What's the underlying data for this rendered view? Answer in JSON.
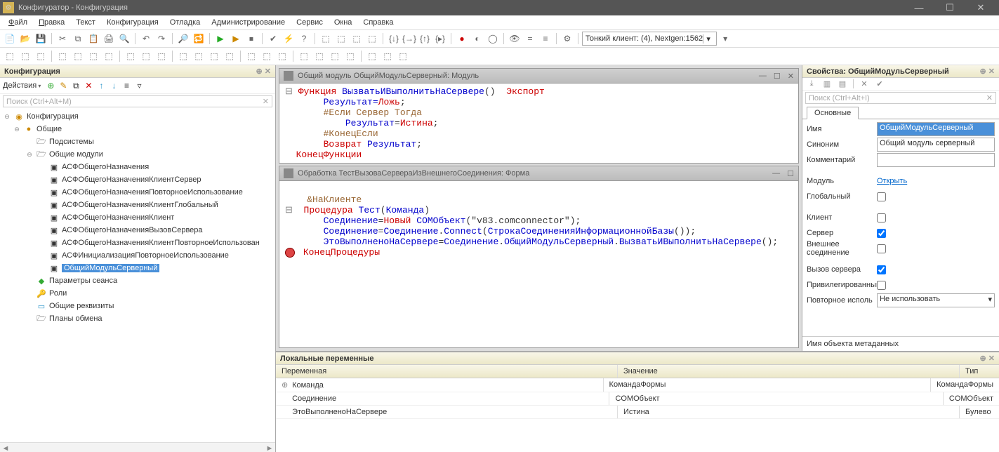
{
  "title": "Конфигуратор - Конфигурация",
  "menu": {
    "file": "Файл",
    "edit": "Правка",
    "text": "Текст",
    "config": "Конфигурация",
    "debug": "Отладка",
    "admin": "Администрирование",
    "service": "Сервис",
    "windows": "Окна",
    "help": "Справка"
  },
  "toolbar_combo": "Тонкий клиент: (4), Nextgen:1562",
  "left": {
    "title": "Конфигурация",
    "actions_label": "Действия",
    "search_placeholder": "Поиск (Ctrl+Alt+M)",
    "root": "Конфигурация",
    "common": "Общие",
    "subsystems": "Подсистемы",
    "common_modules": "Общие модули",
    "mods": [
      "АСФОбщегоНазначения",
      "АСФОбщегоНазначенияКлиентСервер",
      "АСФОбщегоНазначенияПовторноеИспользование",
      "АСФОбщегоНазначенияКлиентГлобальный",
      "АСФОбщегоНазначенияКлиент",
      "АСФОбщегоНазначенияВызовСервера",
      "АСФОбщегоНазначенияКлиентПовторноеИспользован",
      "АСФИнициализацияПовторноеИспользование",
      "ОбщийМодульСерверный"
    ],
    "session_params": "Параметры сеанса",
    "roles": "Роли",
    "common_attrs": "Общие реквизиты",
    "plans": "Планы обмена"
  },
  "editor1": {
    "title": "Общий модуль ОбщийМодульСерверный: Модуль",
    "l1_a": "Функция",
    "l1_b": "ВызватьИВыполнитьНаСервере",
    "l1_c": "Экспорт",
    "l2_a": "Результат",
    "l2_eq": "=",
    "l2_b": "Ложь",
    "l3": "#Если Сервер Тогда",
    "l4_a": "Результат",
    "l4_b": "Истина",
    "l5": "#КонецЕсли",
    "l6_a": "Возврат",
    "l6_b": "Результат",
    "l7": "КонецФункции"
  },
  "editor2": {
    "title": "Обработка ТестВызоваСервераИзВнешнегоСоединения: Форма",
    "l1": "&НаКлиенте",
    "l2_a": "Процедура",
    "l2_b": "Тест",
    "l2_c": "Команда",
    "l3_a": "Соединение",
    "l3_b": "Новый",
    "l3_c": "COMОбъект",
    "l3_d": "\"v83.comconnector\"",
    "l4_a": "Соединение",
    "l4_b": "Соединение",
    "l4_c": "Connect",
    "l4_d": "СтрокаСоединенияИнформационнойБазы",
    "l5_a": "ЭтоВыполненоНаСервере",
    "l5_b": "Соединение",
    "l5_c": "ОбщийМодульСерверный",
    "l5_d": "ВызватьИВыполнитьНаСервере",
    "l6": "КонецПроцедуры"
  },
  "props": {
    "title": "Свойства: ОбщийМодульСерверный",
    "search_placeholder": "Поиск (Ctrl+Alt+I)",
    "tab_main": "Основные",
    "name_lbl": "Имя",
    "name_val": "ОбщийМодульСерверный",
    "syn_lbl": "Синоним",
    "syn_val": "Общий модуль серверный",
    "comment_lbl": "Комментарий",
    "comment_val": "",
    "module_lbl": "Модуль",
    "module_link": "Открыть",
    "global_lbl": "Глобальный",
    "client_lbl": "Клиент",
    "server_lbl": "Сервер",
    "extconn_lbl": "Внешнее соединение",
    "servercall_lbl": "Вызов сервера",
    "priv_lbl": "Привилегированный",
    "reuse_lbl": "Повторное исполь",
    "reuse_val": "Не использовать",
    "hint": "Имя объекта метаданных"
  },
  "locals": {
    "title": "Локальные переменные",
    "h1": "Переменная",
    "h2": "Значение",
    "h3": "Тип",
    "r1c1": "Команда",
    "r1c2": "КомандаФормы",
    "r1c3": "КомандаФормы",
    "r2c1": "Соединение",
    "r2c2": "COMОбъект",
    "r2c3": "COMОбъект",
    "r3c1": "ЭтоВыполненоНаСервере",
    "r3c2": "Истина",
    "r3c3": "Булево"
  }
}
